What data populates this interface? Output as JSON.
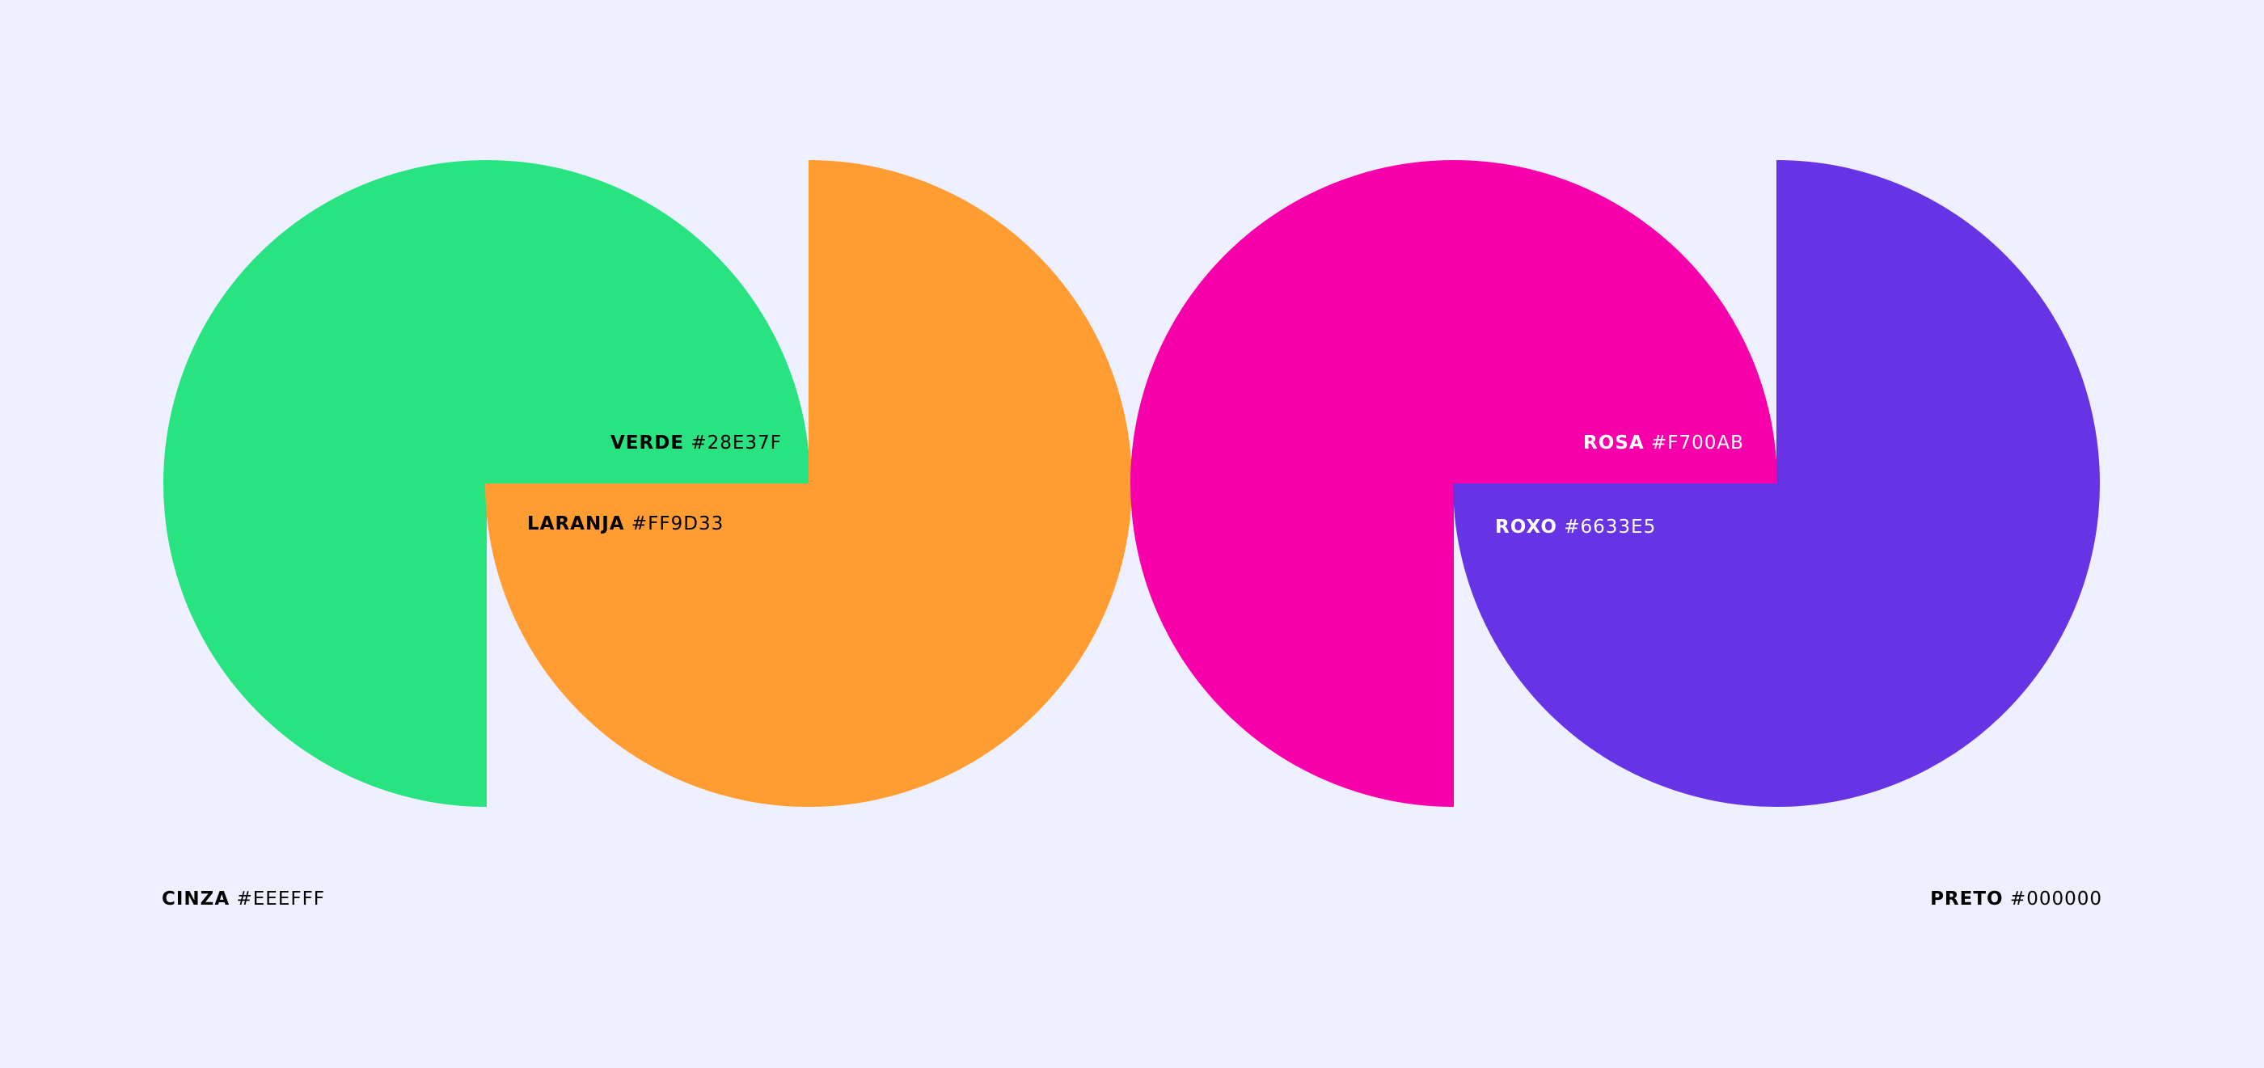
{
  "swatches": [
    {
      "name": "VERDE",
      "hex": "#28E37F",
      "color": "#28E37F"
    },
    {
      "name": "LARANJA",
      "hex": "#FF9D33",
      "color": "#FF9D33"
    },
    {
      "name": "ROSA",
      "hex": "#F700AB",
      "color": "#F700AB"
    },
    {
      "name": "ROXO",
      "hex": "#6633E5",
      "color": "#6633E5"
    },
    {
      "name": "CINZA",
      "hex": "#EEEFFF",
      "color": "#EEF0FF"
    },
    {
      "name": "PRETO",
      "hex": "#000000",
      "color": "#000000"
    }
  ]
}
